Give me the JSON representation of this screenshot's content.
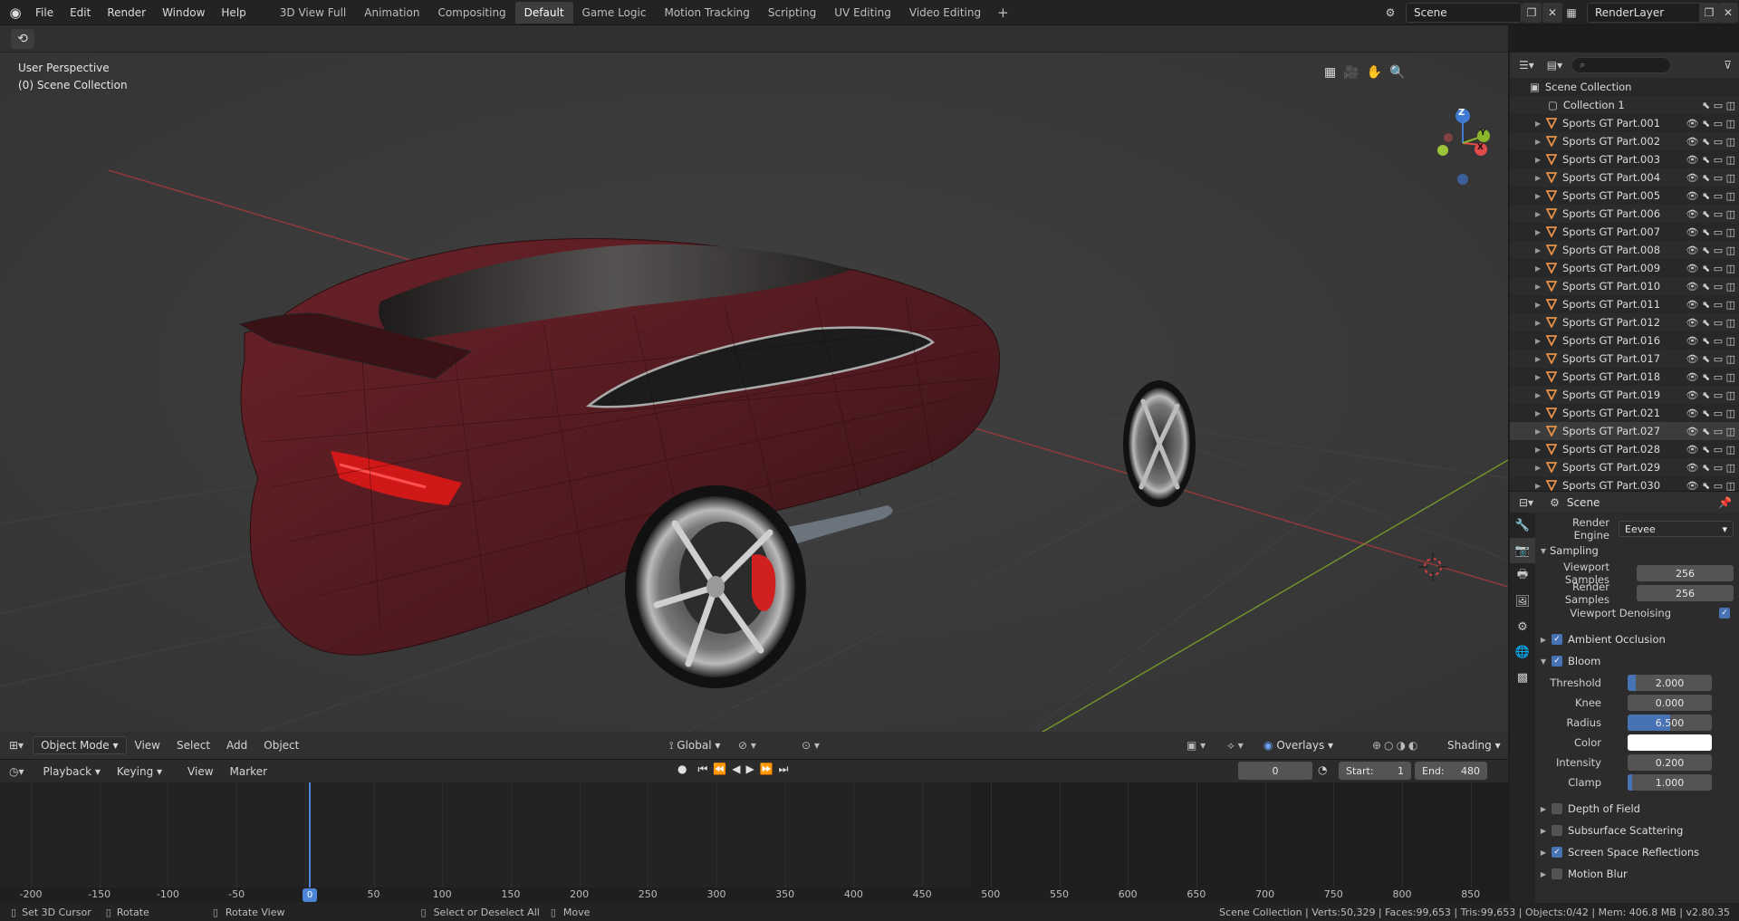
{
  "topbar": {
    "menus": [
      "File",
      "Edit",
      "Render",
      "Window",
      "Help"
    ],
    "workspaces": [
      "3D View Full",
      "Animation",
      "Compositing",
      "Default",
      "Game Logic",
      "Motion Tracking",
      "Scripting",
      "UV Editing",
      "Video Editing"
    ],
    "active_workspace": "Default",
    "scene_name": "Scene",
    "view_layer": "RenderLayer"
  },
  "viewport": {
    "view_name": "User Perspective",
    "collection_label": "(0) Scene Collection",
    "gizmo_axes": [
      "Z",
      "Y",
      "X"
    ],
    "header": {
      "mode": "Object Mode",
      "menus": [
        "View",
        "Select",
        "Add",
        "Object"
      ],
      "orientation": "Global",
      "overlays": "Overlays",
      "shading": "Shading"
    }
  },
  "timeline": {
    "menus": [
      "Playback",
      "Keying",
      "View",
      "Marker"
    ],
    "current_frame": "0",
    "start_label": "Start:",
    "start": "1",
    "end_label": "End:",
    "end": "480",
    "ruler": [
      "-200",
      "-150",
      "-100",
      "-50",
      "0",
      "50",
      "100",
      "150",
      "200",
      "250",
      "300",
      "350",
      "400",
      "450",
      "500",
      "550",
      "600",
      "650",
      "700",
      "750",
      "800",
      "850"
    ]
  },
  "outliner": {
    "root": "Scene Collection",
    "collection": "Collection 1",
    "objects": [
      "Sports GT Part.001",
      "Sports GT Part.002",
      "Sports GT Part.003",
      "Sports GT Part.004",
      "Sports GT Part.005",
      "Sports GT Part.006",
      "Sports GT Part.007",
      "Sports GT Part.008",
      "Sports GT Part.009",
      "Sports GT Part.010",
      "Sports GT Part.011",
      "Sports GT Part.012",
      "Sports GT Part.016",
      "Sports GT Part.017",
      "Sports GT Part.018",
      "Sports GT Part.019",
      "Sports GT Part.021",
      "Sports GT Part.027",
      "Sports GT Part.028",
      "Sports GT Part.029",
      "Sports GT Part.030"
    ],
    "selected": "Sports GT Part.027"
  },
  "properties": {
    "context": "Scene",
    "render_engine_label": "Render Engine",
    "render_engine": "Eevee",
    "sampling": "Sampling",
    "viewport_samples_label": "Viewport Samples",
    "viewport_samples": "256",
    "render_samples_label": "Render Samples",
    "render_samples": "256",
    "viewport_denoising": "Viewport Denoising",
    "ambient_occlusion": "Ambient Occlusion",
    "bloom": "Bloom",
    "threshold_label": "Threshold",
    "threshold": "2.000",
    "threshold_fill": 0.1,
    "knee_label": "Knee",
    "knee": "0.000",
    "radius_label": "Radius",
    "radius": "6.500",
    "radius_fill": 0.5,
    "color_label": "Color",
    "intensity_label": "Intensity",
    "intensity": "0.200",
    "clamp_label": "Clamp",
    "clamp": "1.000",
    "clamp_fill": 0.05,
    "depth_of_field": "Depth of Field",
    "subsurface_scattering": "Subsurface Scattering",
    "screen_space_reflections": "Screen Space Reflections",
    "motion_blur": "Motion Blur"
  },
  "statusbar": {
    "set_cursor": "Set 3D Cursor",
    "rotate": "Rotate",
    "rotate_view": "Rotate View",
    "select": "Select or Deselect All",
    "move": "Move",
    "stats": "Scene Collection | Verts:50,329 | Faces:99,653 | Tris:99,653 | Objects:0/42 | Mem: 406.8 MB | v2.80.35"
  },
  "colors": {
    "accent": "#4772b3",
    "car_body": "#5a1c20",
    "x_axis": "#c0392b",
    "y_axis": "#7fa82a"
  }
}
